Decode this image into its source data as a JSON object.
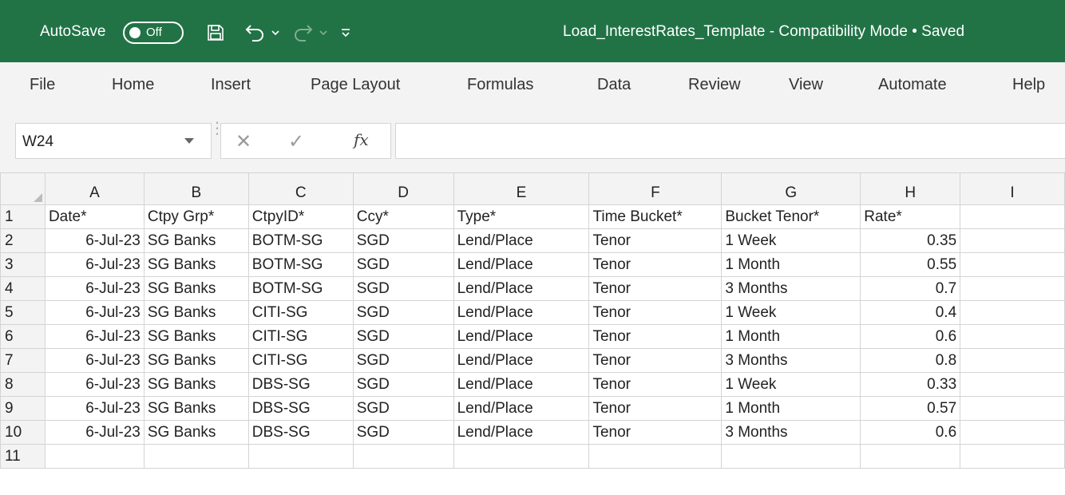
{
  "titlebar": {
    "autosave_label": "AutoSave",
    "autosave_state": "Off",
    "document_title": "Load_InterestRates_Template  -  Compatibility Mode  •  Saved",
    "icons": [
      "save-icon",
      "undo-icon",
      "redo-icon",
      "customize-qat-icon"
    ]
  },
  "menu": {
    "items": [
      "File",
      "Home",
      "Insert",
      "Page Layout",
      "Formulas",
      "Data",
      "Review",
      "View",
      "Automate",
      "Help"
    ]
  },
  "formula_bar": {
    "name_box": "W24",
    "fx_label": "fx",
    "formula": ""
  },
  "sheet": {
    "column_headers": [
      "A",
      "B",
      "C",
      "D",
      "E",
      "F",
      "G",
      "H",
      "I"
    ],
    "row_numbers": [
      "1",
      "2",
      "3",
      "4",
      "5",
      "6",
      "7",
      "8",
      "9",
      "10",
      "11"
    ],
    "rows": [
      [
        "Date*",
        "Ctpy Grp*",
        "CtpyID*",
        "Ccy*",
        "Type*",
        "Time Bucket*",
        "Bucket Tenor*",
        "Rate*",
        ""
      ],
      [
        "6-Jul-23",
        "SG Banks",
        "BOTM-SG",
        "SGD",
        "Lend/Place",
        "Tenor",
        "1 Week",
        "0.35",
        ""
      ],
      [
        "6-Jul-23",
        "SG Banks",
        "BOTM-SG",
        "SGD",
        "Lend/Place",
        "Tenor",
        "1 Month",
        "0.55",
        ""
      ],
      [
        "6-Jul-23",
        "SG Banks",
        "BOTM-SG",
        "SGD",
        "Lend/Place",
        "Tenor",
        "3 Months",
        "0.7",
        ""
      ],
      [
        "6-Jul-23",
        "SG Banks",
        "CITI-SG",
        "SGD",
        "Lend/Place",
        "Tenor",
        "1 Week",
        "0.4",
        ""
      ],
      [
        "6-Jul-23",
        "SG Banks",
        "CITI-SG",
        "SGD",
        "Lend/Place",
        "Tenor",
        "1 Month",
        "0.6",
        ""
      ],
      [
        "6-Jul-23",
        "SG Banks",
        "CITI-SG",
        "SGD",
        "Lend/Place",
        "Tenor",
        "3 Months",
        "0.8",
        ""
      ],
      [
        "6-Jul-23",
        "SG Banks",
        "DBS-SG",
        "SGD",
        "Lend/Place",
        "Tenor",
        "1 Week",
        "0.33",
        ""
      ],
      [
        "6-Jul-23",
        "SG Banks",
        "DBS-SG",
        "SGD",
        "Lend/Place",
        "Tenor",
        "1 Month",
        "0.57",
        ""
      ],
      [
        "6-Jul-23",
        "SG Banks",
        "DBS-SG",
        "SGD",
        "Lend/Place",
        "Tenor",
        "3 Months",
        "0.6",
        ""
      ],
      [
        "",
        "",
        "",
        "",
        "",
        "",
        "",
        "",
        ""
      ]
    ]
  },
  "colors": {
    "title_bar": "#217346",
    "chrome": "#f3f3f3",
    "gridline": "#d4d4d4"
  }
}
